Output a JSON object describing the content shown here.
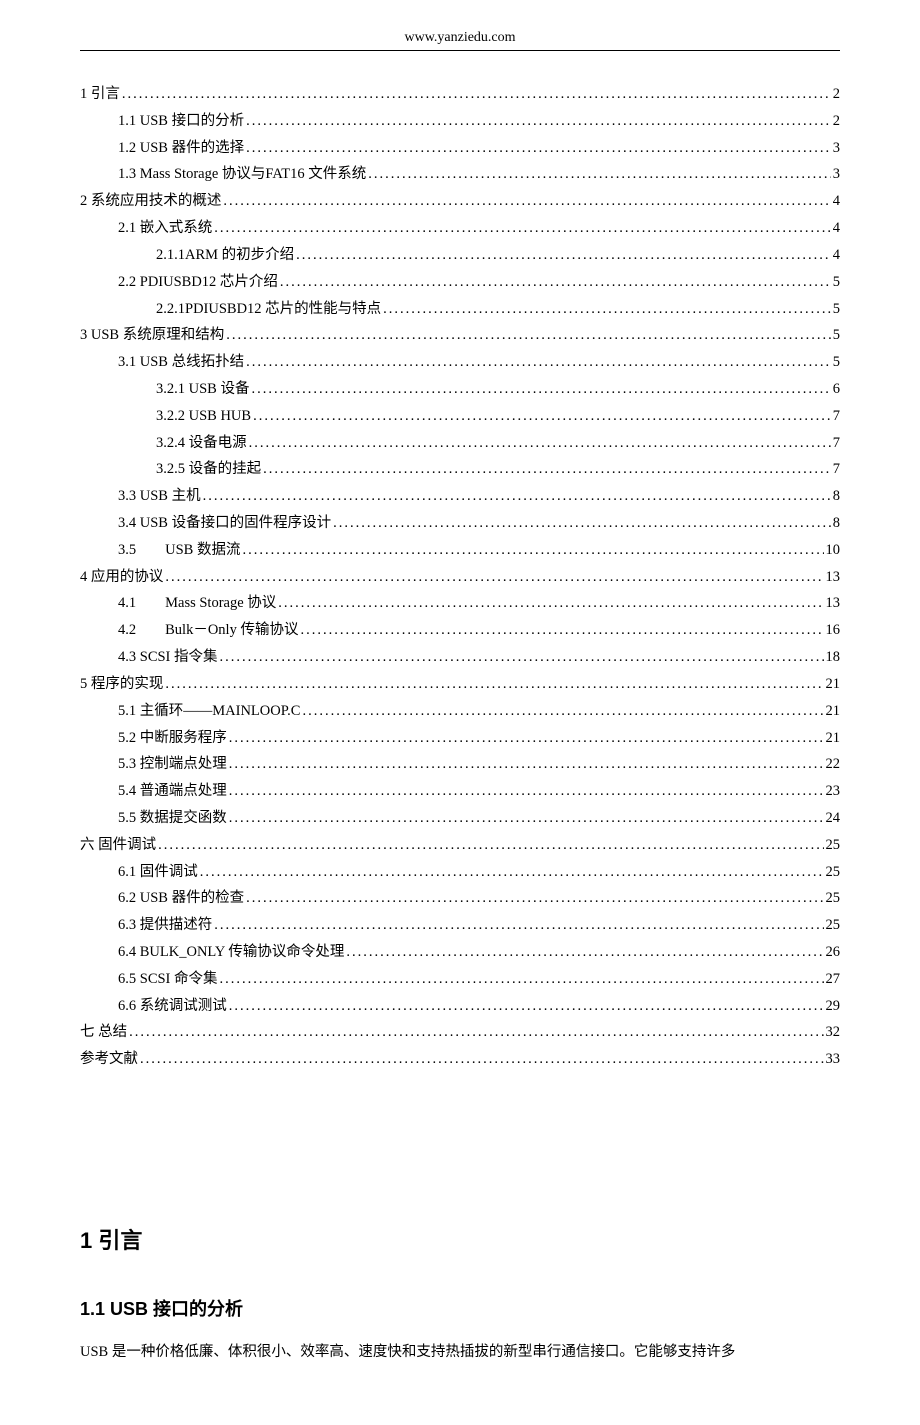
{
  "header": {
    "url": "www.yanziedu.com"
  },
  "toc": [
    {
      "level": 0,
      "title": "1 引言",
      "page": "2"
    },
    {
      "level": 1,
      "title": "1.1 USB 接口的分析",
      "page": "2"
    },
    {
      "level": 1,
      "title": "1.2 USB 器件的选择",
      "page": "3"
    },
    {
      "level": 1,
      "title": "1.3 Mass Storage 协议与FAT16 文件系统",
      "page": "3"
    },
    {
      "level": 0,
      "title": "2 系统应用技术的概述",
      "page": "4"
    },
    {
      "level": 1,
      "title": "2.1 嵌入式系统",
      "page": "4"
    },
    {
      "level": 2,
      "title": "2.1.1ARM 的初步介绍",
      "page": "4"
    },
    {
      "level": 1,
      "title": "2.2 PDIUSBD12 芯片介绍",
      "page": "5"
    },
    {
      "level": 2,
      "title": "2.2.1PDIUSBD12 芯片的性能与特点",
      "page": "5"
    },
    {
      "level": 0,
      "title": "3 USB 系统原理和结构",
      "page": "5"
    },
    {
      "level": 1,
      "title": "3.1 USB 总线拓扑结",
      "page": "5"
    },
    {
      "level": 2,
      "title": "3.2.1 USB 设备",
      "page": "6"
    },
    {
      "level": 2,
      "title": "3.2.2 USB HUB",
      "page": "7"
    },
    {
      "level": 2,
      "title": "3.2.4 设备电源",
      "page": "7"
    },
    {
      "level": 2,
      "title": "3.2.5 设备的挂起",
      "page": "7"
    },
    {
      "level": 1,
      "title": "3.3 USB 主机",
      "page": "8"
    },
    {
      "level": 1,
      "title": "3.4 USB 设备接口的固件程序设计",
      "page": "8"
    },
    {
      "level": 1,
      "title": "3.5　　USB 数据流",
      "page": "10"
    },
    {
      "level": 0,
      "title": "4 应用的协议",
      "page": "13"
    },
    {
      "level": 1,
      "title": "4.1　　Mass Storage 协议",
      "page": "13"
    },
    {
      "level": 1,
      "title": "4.2　　Bulk－Only 传输协议",
      "page": "16"
    },
    {
      "level": 1,
      "title": "4.3 SCSI 指令集",
      "page": "18"
    },
    {
      "level": 0,
      "title": "5 程序的实现",
      "page": "21"
    },
    {
      "level": 1,
      "title": "5.1 主循环——MAINLOOP.C",
      "page": "21"
    },
    {
      "level": 1,
      "title": "5.2 中断服务程序",
      "page": "21"
    },
    {
      "level": 1,
      "title": "5.3 控制端点处理",
      "page": "22"
    },
    {
      "level": 1,
      "title": "5.4 普通端点处理",
      "page": "23"
    },
    {
      "level": 1,
      "title": "5.5 数据提交函数",
      "page": "24"
    },
    {
      "level": 0,
      "title": "六 固件调试",
      "page": "25"
    },
    {
      "level": 1,
      "title": "6.1 固件调试",
      "page": "25"
    },
    {
      "level": 1,
      "title": "6.2 USB 器件的检查",
      "page": "25"
    },
    {
      "level": 1,
      "title": "6.3 提供描述符",
      "page": "25"
    },
    {
      "level": 1,
      "title": "6.4 BULK_ONLY 传输协议命令处理",
      "page": "26"
    },
    {
      "level": 1,
      "title": "6.5 SCSI 命令集",
      "page": "27"
    },
    {
      "level": 1,
      "title": "6.6 系统调试测试",
      "page": "29"
    },
    {
      "level": 0,
      "title": "七 总结",
      "page": "32"
    },
    {
      "level": 0,
      "title": "参考文献",
      "page": "33",
      "bold": true
    }
  ],
  "sections": {
    "h1": "1 引言",
    "h2": "1.1 USB 接口的分析",
    "para": "USB 是一种价格低廉、体积很小、效率高、速度快和支持热插拔的新型串行通信接口。它能够支持许多"
  }
}
